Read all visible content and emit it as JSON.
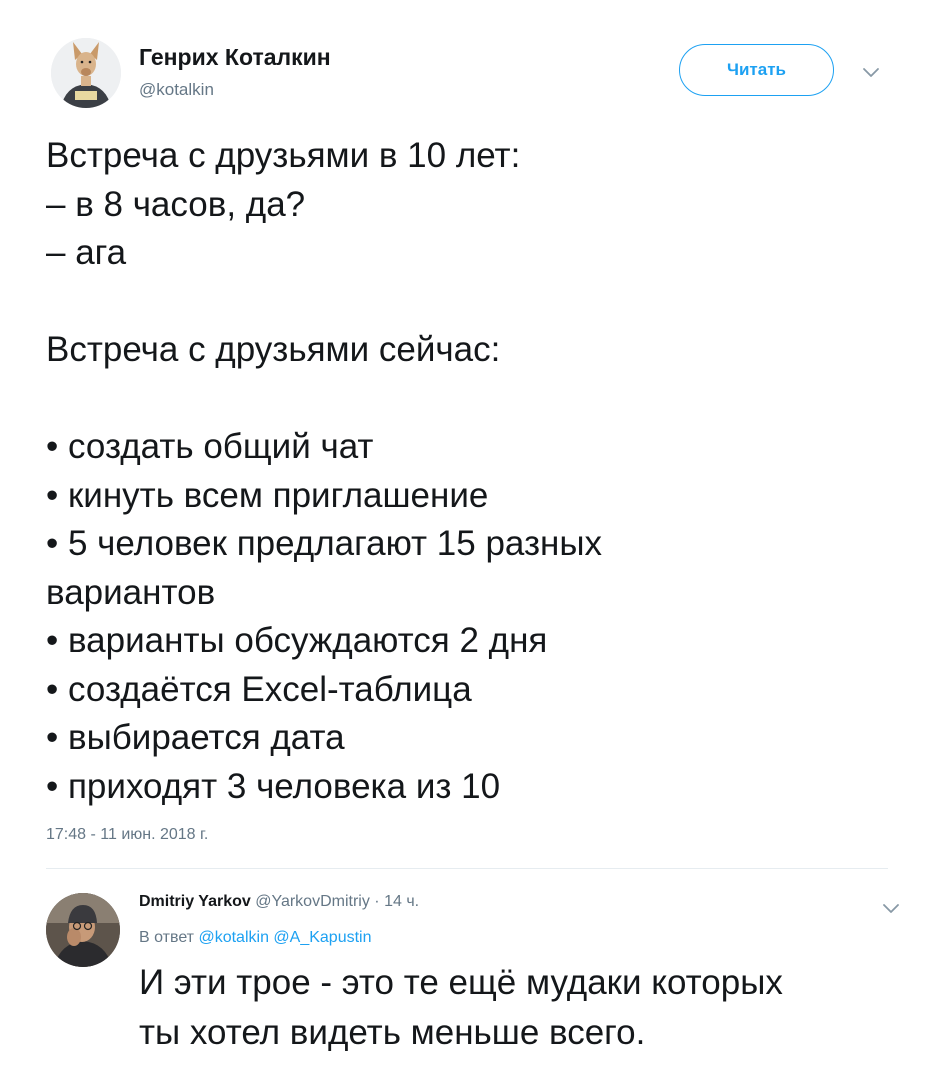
{
  "tweet": {
    "author": {
      "name": "Генрих Коталкин",
      "handle": "@kotalkin"
    },
    "follow_label": "Читать",
    "lines": [
      "Встреча с друзьями в 10 лет:",
      "– в 8 часов, да?",
      "– ага",
      "",
      "Встреча с друзьями сейчас:",
      "",
      "• создать общий чат",
      "• кинуть всем приглашение",
      "• 5 человек предлагают 15 разных",
      "вариантов",
      "• варианты обсуждаются 2 дня",
      "• создаётся Excel-таблица",
      "• выбирается дата",
      "• приходят 3 человека из 10"
    ],
    "timestamp": "17:48 - 11 июн. 2018 г."
  },
  "reply": {
    "author": {
      "name": "Dmitriy Yarkov",
      "handle": "@YarkovDmitriy",
      "time": "· 14 ч."
    },
    "reply_to": {
      "prefix": "В ответ",
      "mentions": [
        "@kotalkin",
        "@A_Kapustin"
      ]
    },
    "lines": [
      "И эти трое - это те ещё мудаки которых",
      "ты хотел видеть меньше всего."
    ]
  },
  "icons": {
    "chevron": "chevron-down-icon",
    "main_avatar": "dog-avatar-icon",
    "reply_avatar": "user-avatar-icon"
  },
  "colors": {
    "accent": "#1da1f2",
    "text": "#14171a",
    "secondary": "#657786",
    "divider": "#e6ecf0"
  }
}
